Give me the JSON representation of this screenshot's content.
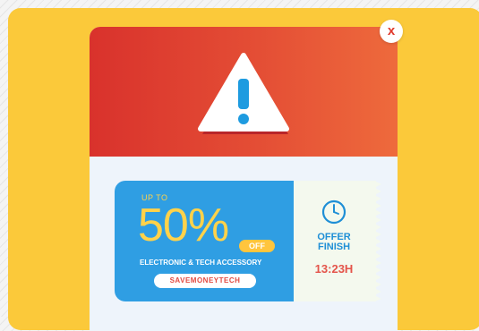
{
  "close_label": "x",
  "coupon": {
    "up_to": "UP TO",
    "discount": "50%",
    "off": "OFF",
    "category": "ELECTRONIC & TECH ACCESSORY",
    "promo_code": "SAVEMONEYTECH"
  },
  "offer": {
    "label_line1": "OFFER",
    "label_line2": "FINISH",
    "time_left": "13:23H"
  },
  "colors": {
    "panel": "#fbc93a",
    "header_red": "#d9322c",
    "header_orange": "#ee6a3c",
    "coupon_blue": "#2f9ee3",
    "accent_yellow": "#ffd24a",
    "time_red": "#e4544a"
  },
  "icons": {
    "warning": "warning-triangle-icon",
    "close": "close-icon",
    "clock": "clock-icon"
  }
}
